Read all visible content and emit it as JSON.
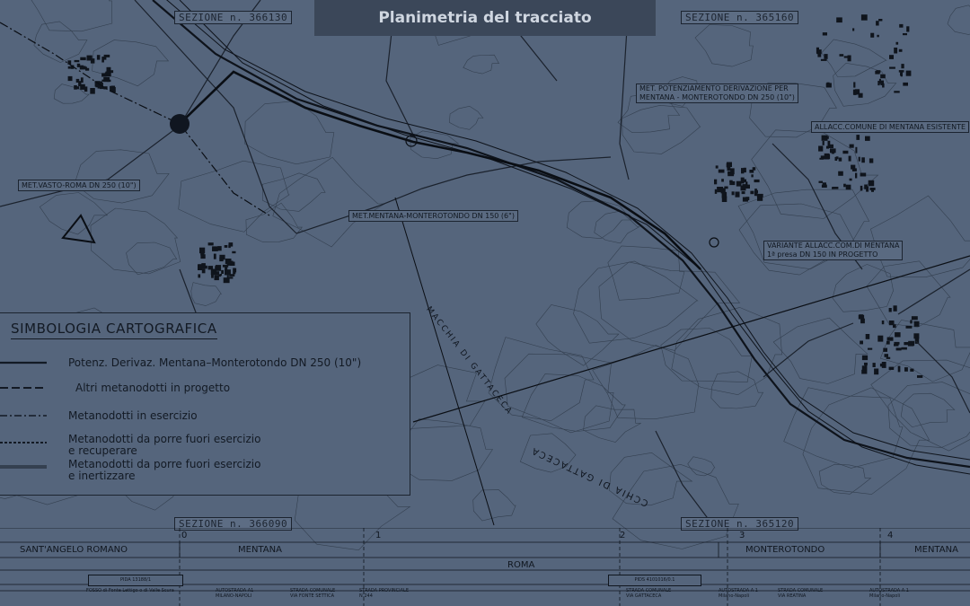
{
  "title": "Planimetria del tracciato",
  "sections": {
    "top_left": "SEZIONE n. 366130",
    "top_right": "SEZIONE n. 365160",
    "bottom_left": "SEZIONE n. 366090",
    "bottom_right": "SEZIONE n. 365120"
  },
  "map_labels": {
    "pipeline_left": "MET.VASTO-ROMA DN 250 (10\")",
    "pipeline_center": "MET.MENTANA-MONTEROTONDO DN 150 (6\")",
    "potenziamento_line1": "MET. POTENZIAMENTO DERIVAZIONE PER",
    "potenziamento_line2": "MENTANA - MONTEROTONDO DN 250 (10\")",
    "allacc_existing": "ALLACC.COMUNE DI MENTANA ESISTENTE",
    "variante_line1": "VARIANTE ALLACC.COM.DI MENTANA",
    "variante_line2": "1ª presa DN 150 IN PROGETTO",
    "macchia_1": "MACCHIA DI GATTACECA",
    "macchia_2": "CCHIA DI GATTACECA"
  },
  "legend": {
    "title": "SIMBOLOGIA CARTOGRAFICA",
    "items": [
      {
        "style": "solid",
        "text": "Potenz. Derivaz. Mentana–Monterotondo DN 250 (10\")"
      },
      {
        "style": "dashed",
        "text": "Altri metanodotti in progetto"
      },
      {
        "style": "dashdot",
        "text": "Metanodotti in esercizio"
      },
      {
        "style": "dotted",
        "text": "Metanodotti da porre fuori esercizio",
        "text2": "e recuperare"
      },
      {
        "style": "double",
        "text": "Metanodotti da porre fuori esercizio",
        "text2": "e inertizzare"
      }
    ]
  },
  "profile": {
    "km_marks": [
      "0",
      "1",
      "2",
      "3",
      "4"
    ],
    "municipalities": [
      "SANT'ANGELO ROMANO",
      "MENTANA",
      "MONTEROTONDO",
      "MENTANA"
    ],
    "province": "ROMA",
    "markers": [
      "PIDA 13188/1",
      "PIDS 4101016/0.1"
    ],
    "crossings": [
      "FOSSO di Fonte Lettigo o di Valle Scura",
      "AUTOSTRADA A1 MILANO-NAPOLI",
      "STRADA COMUNALE VIA FONTE SETTICA",
      "STRADA PROVINCIALE N.244",
      "STRADA COMUNALE VIA GATTACECA",
      "AUTOSTRADA A 1 Milano-Napoli",
      "STRADA COMUNALE VIA REATINA",
      "AUTOSTRADA A 1 Milano-Napoli"
    ]
  },
  "colors": {
    "background": "#55657c",
    "ink": "#161d28",
    "title_bar": "#3b4759",
    "title_text": "#cfd6e0"
  }
}
